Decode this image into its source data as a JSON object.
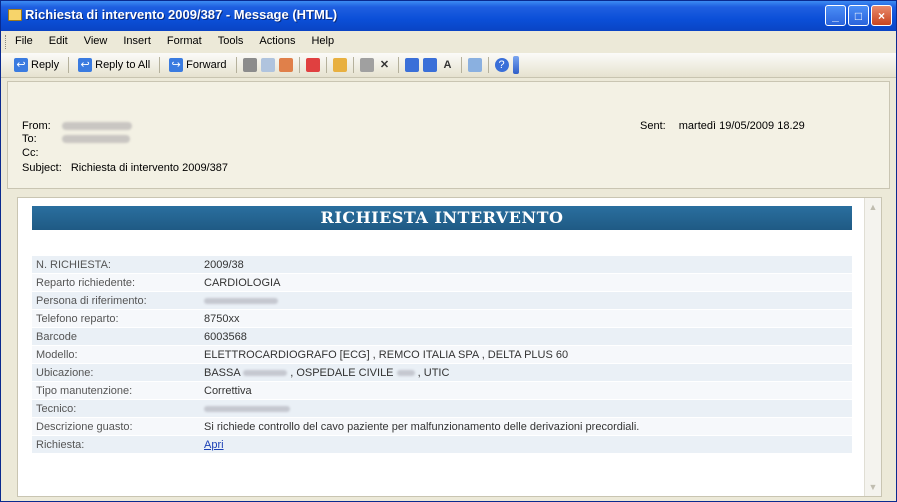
{
  "window": {
    "title": "Richiesta di intervento 2009/387 - Message (HTML)",
    "buttons": [
      "_",
      "□",
      "×"
    ]
  },
  "menu": [
    "File",
    "Edit",
    "View",
    "Insert",
    "Format",
    "Tools",
    "Actions",
    "Help"
  ],
  "toolbar": {
    "reply": "Reply",
    "reply_all": "Reply to All",
    "forward": "Forward",
    "icons": [
      "print-icon",
      "copy-icon",
      "flag-icon",
      "envelope-icon",
      "delete-icon",
      "up-icon",
      "down-icon",
      "font-icon",
      "help-icon"
    ],
    "delete_glyph": "✕",
    "font_glyph": "A",
    "help_glyph": "?"
  },
  "header": {
    "from_label": "From:",
    "to_label": "To:",
    "cc_label": "Cc:",
    "subject_label": "Subject:",
    "subject": "Richiesta di intervento 2009/387",
    "sent_label": "Sent:",
    "sent_value": "martedì 19/05/2009 18.29"
  },
  "body": {
    "title": "RICHIESTA INTERVENTO",
    "rows": [
      {
        "k": "N. RICHIESTA:",
        "v": "2009/38"
      },
      {
        "k": "Reparto richiedente:",
        "v": "CARDIOLOGIA"
      },
      {
        "k": "Persona di riferimento:",
        "v": ""
      },
      {
        "k": "Telefono reparto:",
        "v": "8750xx"
      },
      {
        "k": "Barcode",
        "v": "6003568"
      },
      {
        "k": "Modello:",
        "v": "ELETTROCARDIOGRAFO [ECG] , REMCO ITALIA SPA , DELTA PLUS 60"
      },
      {
        "k": "Ubicazione:",
        "v": "BASSA",
        "v2": ", OSPEDALE CIVILE",
        "v3": ", UTIC"
      },
      {
        "k": "Tipo manutenzione:",
        "v": "Correttiva"
      },
      {
        "k": "Tecnico:",
        "v": ""
      },
      {
        "k": "Descrizione guasto:",
        "v": "Si richiede controllo del cavo paziente per malfunzionamento delle derivazioni precordiali."
      },
      {
        "k": "Richiesta:",
        "v": "Apri"
      }
    ]
  }
}
